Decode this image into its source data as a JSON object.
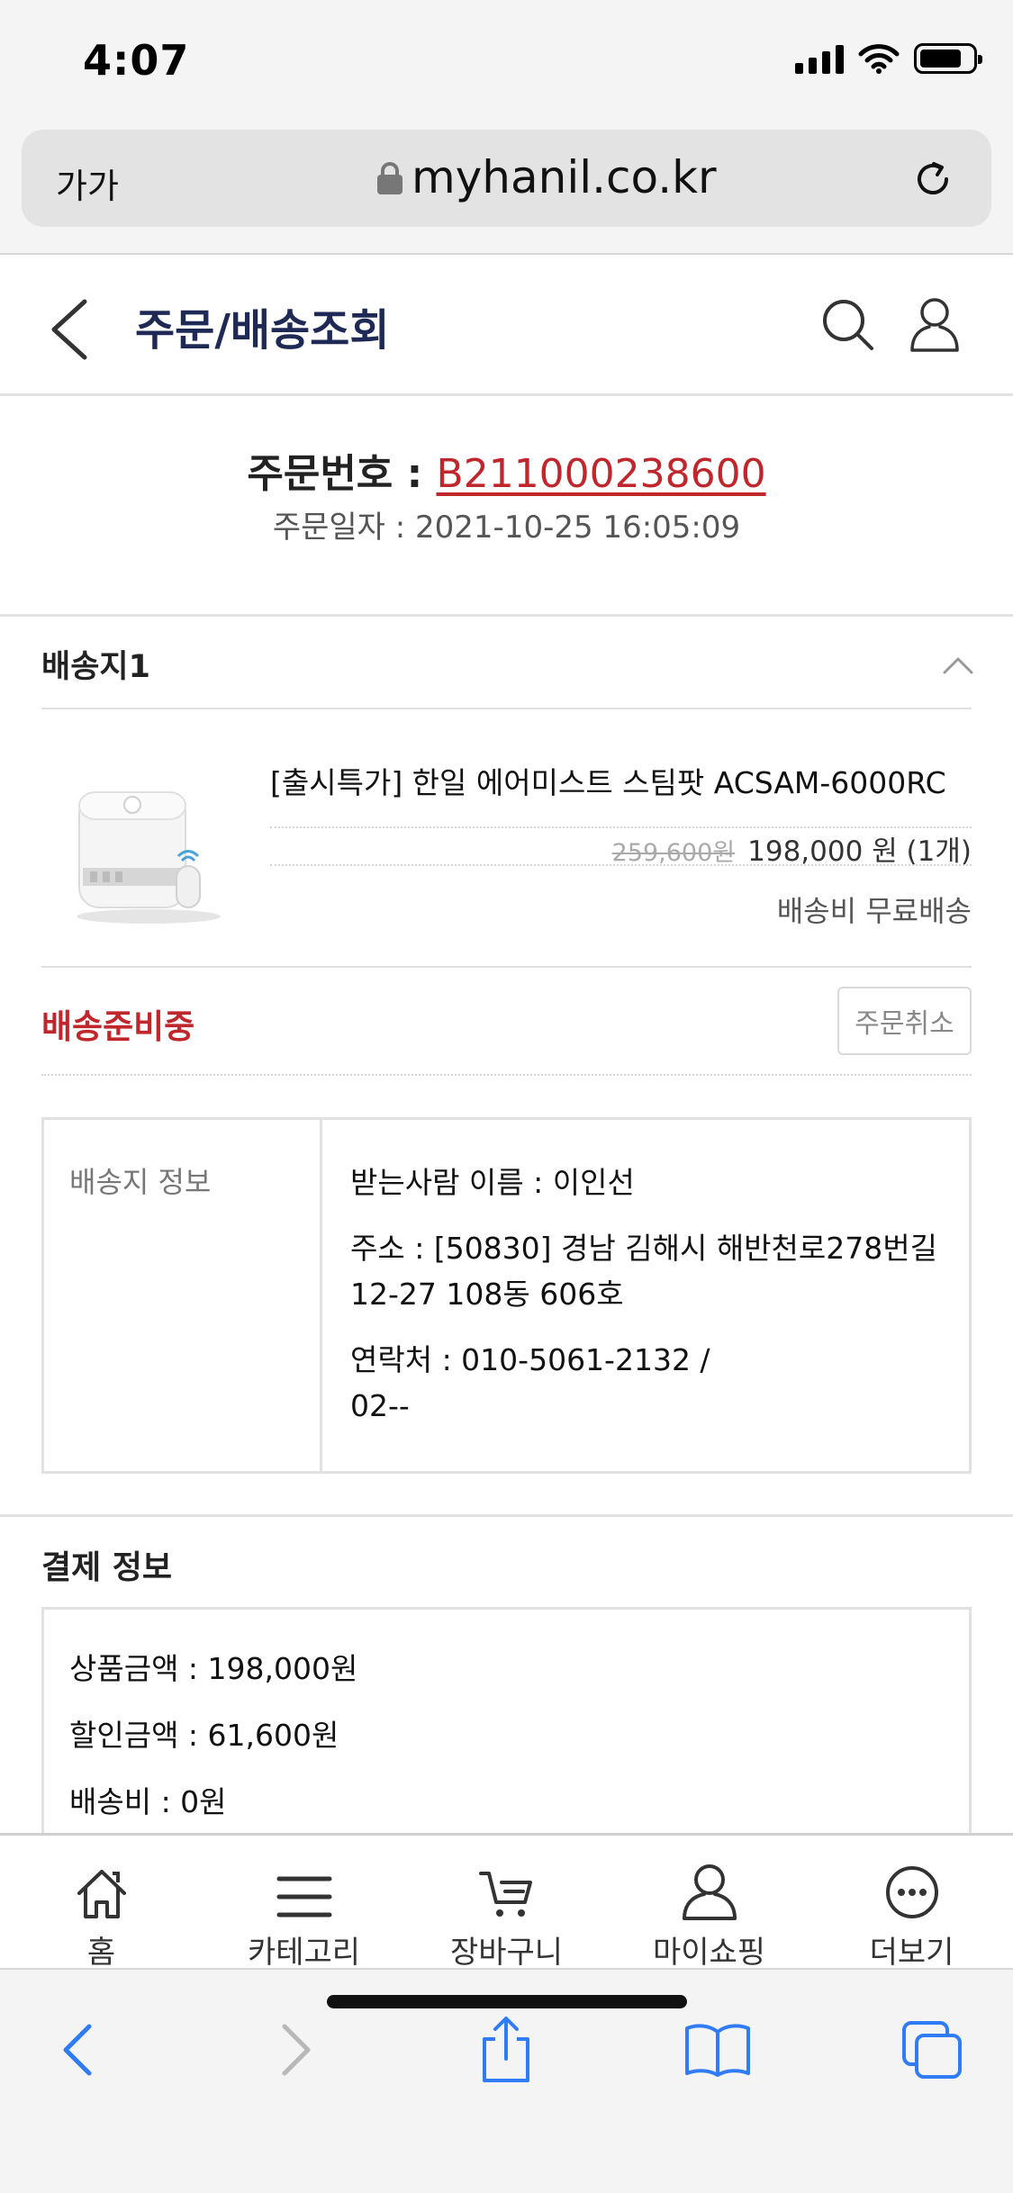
{
  "status_bar": {
    "time": "4:07"
  },
  "browser": {
    "text_size_label": "가가",
    "url": "myhanil.co.kr"
  },
  "header": {
    "title": "주문/배송조회"
  },
  "order": {
    "number_label": "주문번호 : ",
    "number": "B211000238600",
    "date_text": "주문일자 : 2021-10-25 16:05:09"
  },
  "shipment": {
    "heading": "배송지1",
    "product_name": "[출시특가] 한일 에어미스트 스팀팟 ACSAM-6000RC",
    "price_original": "259,600원",
    "price_sale": "198,000 원 (1개)",
    "shipping_fee": "배송비 무료배송",
    "status": "배송준비중",
    "cancel_label": "주문취소"
  },
  "address_info": {
    "label": "배송지 정보",
    "recipient": "받는사람 이름 : 이인선",
    "address": "주소 : [50830] 경남 김해시 해반천로278번길 12-27 108동 606호",
    "contact_line1": "연락처 : 010-5061-2132 /",
    "contact_line2": "02--"
  },
  "payment": {
    "heading": "결제 정보",
    "product_amount": "상품금액 : 198,000원",
    "discount_amount": "할인금액 : 61,600원",
    "shipping_cost": "배송비 : 0원"
  },
  "bottom_nav": [
    {
      "label": "홈",
      "icon": "home-icon"
    },
    {
      "label": "카테고리",
      "icon": "menu-icon"
    },
    {
      "label": "장바구니",
      "icon": "cart-icon"
    },
    {
      "label": "마이쇼핑",
      "icon": "user-icon"
    },
    {
      "label": "더보기",
      "icon": "more-icon"
    }
  ],
  "colors": {
    "accent_red": "#c0272d",
    "title_navy": "#1e2a55",
    "ios_blue": "#2f7cf6"
  }
}
